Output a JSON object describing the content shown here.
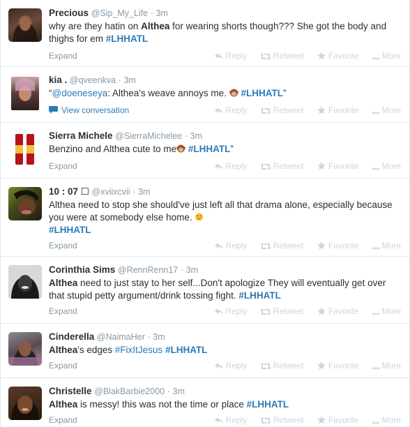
{
  "actions": {
    "reply": "Reply",
    "retweet": "Retweet",
    "favorite": "Favorite",
    "more": "More",
    "expand": "Expand",
    "view_conversation": "View conversation"
  },
  "tweets": [
    {
      "name": "Precious",
      "handle": "@Sip_My_Life",
      "sep": "·",
      "time": "3m",
      "t1": "why are they hatin on ",
      "t2": "Althea",
      "t3": " for wearing shorts though??? She got the body and thighs for em ",
      "tag": "#LHHATL"
    },
    {
      "name": "kia .",
      "handle": "@qveenkva",
      "sep": "·",
      "time": "3m",
      "q1": "“",
      "mention": "@doeneseya",
      "q2": ": Althea's weave annoys me. ",
      "tag": "#LHHATL",
      "q3": "”"
    },
    {
      "name": "Sierra Michele",
      "handle": "@SierraMichelee",
      "sep": "·",
      "time": "3m",
      "t1": "Benzino and Althea cute to me",
      "tag": "#LHHATL",
      "t3": "”"
    },
    {
      "name": "10 : 07 ",
      "name_glyph": "☐",
      "handle": "@xviixcvii",
      "sep": "·",
      "time": "3m",
      "t1": "Althea need to stop she should've just left all that drama alone, especially because you were at somebody else home. ",
      "tag": "#LHHATL"
    },
    {
      "name": "Corinthia Sims",
      "handle": "@RennRenn17",
      "sep": "·",
      "time": "3m",
      "t1": "Althea",
      "t2": " need to just stay to her self...Don't apologize They will eventually get over that stupid petty argument/drink tossing fight. ",
      "tag": "#LHHATL"
    },
    {
      "name": "Cinderella",
      "handle": "@NaimaHer",
      "sep": "·",
      "time": "3m",
      "t1": "Althea",
      "t2": "'s edges ",
      "tag1": "#FixItJesus",
      "tag": "#LHHATL"
    },
    {
      "name": "Christelle",
      "handle": "@BlakBarbie2000",
      "sep": "·",
      "time": "3m",
      "t1": "Althea",
      "t2": " is messy! this was not the time or place ",
      "tag": "#LHHATL"
    }
  ],
  "colors": {
    "link": "#2a7ab8",
    "muted": "#8899a6",
    "action": "#ccd6dd",
    "divider": "#e1e8ed"
  }
}
